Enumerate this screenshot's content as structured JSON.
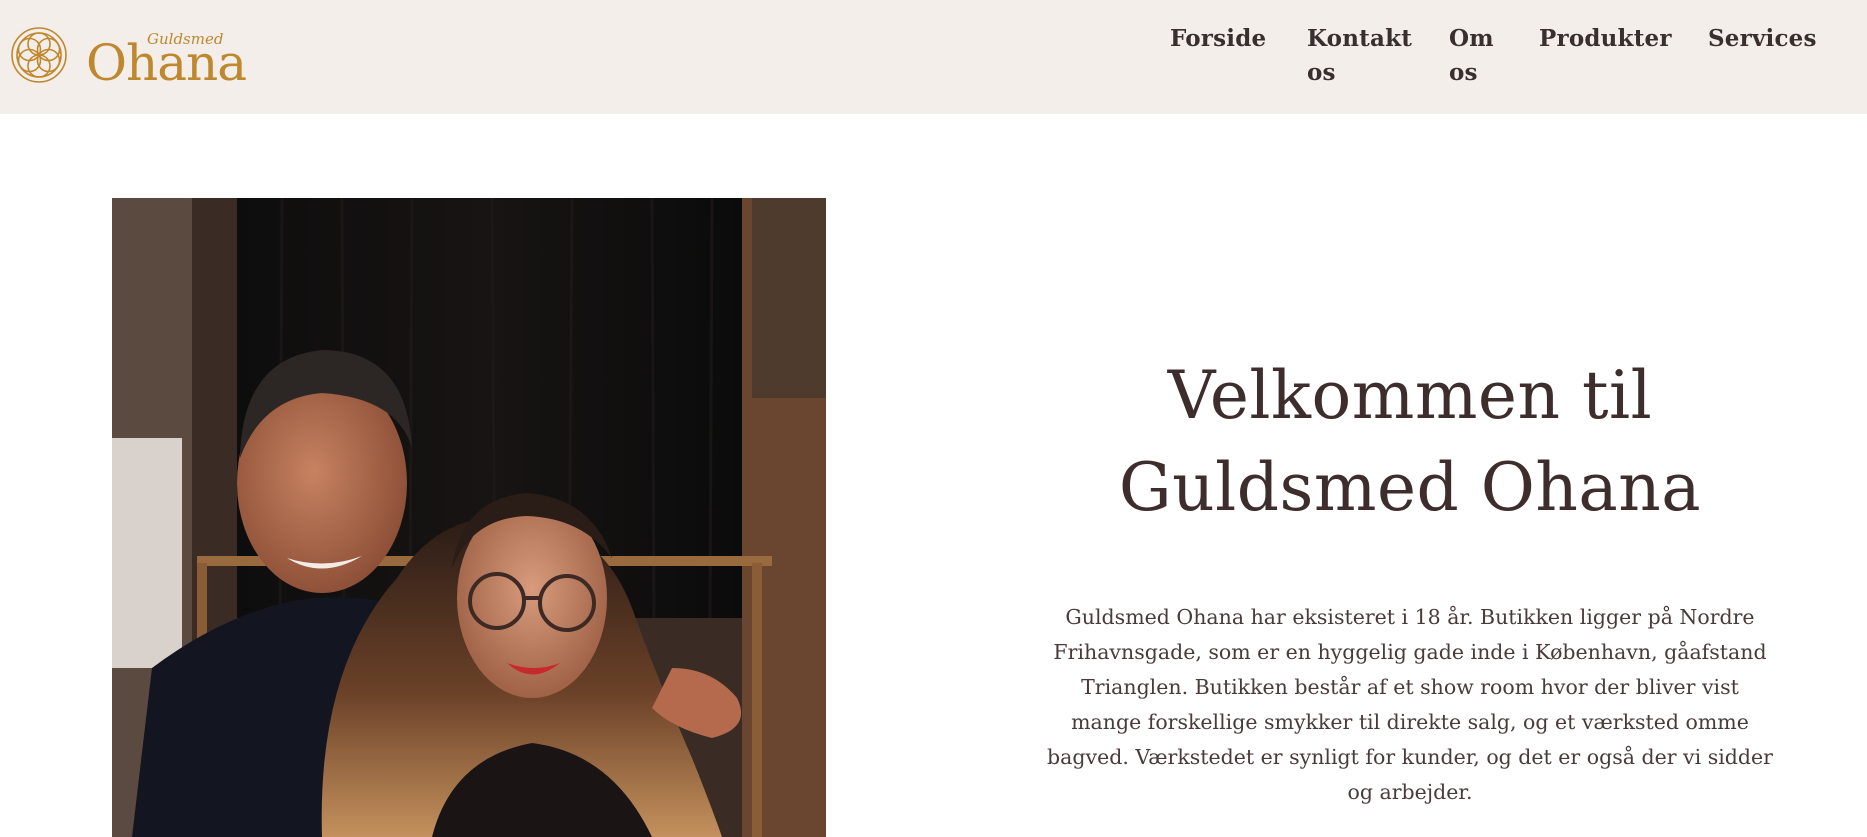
{
  "brand": {
    "logo_top": "Guldsmed",
    "logo_main": "Ohana"
  },
  "nav": {
    "items": [
      {
        "label": "Forside"
      },
      {
        "label": "Kontakt os"
      },
      {
        "label": "Om os"
      },
      {
        "label": "Produkter"
      },
      {
        "label": "Services"
      }
    ]
  },
  "hero": {
    "title": "Velkommen til Guldsmed Ohana",
    "intro": "Guldsmed Ohana har eksisteret i 18 år. Butikken ligger på Nordre Frihavnsgade, som er en hyggelig gade inde i København, gåafstand Trianglen. Butikken består af et show room hvor der bliver vist mange forskellige smykker til direkte salg, og et værksted omme bagved. Værkstedet er synligt for kunder, og det er også der vi sidder og arbejder."
  },
  "colors": {
    "header_bg": "#f3eeea",
    "logo_gold": "#c0882e",
    "text_dark": "#3d2d2d"
  }
}
